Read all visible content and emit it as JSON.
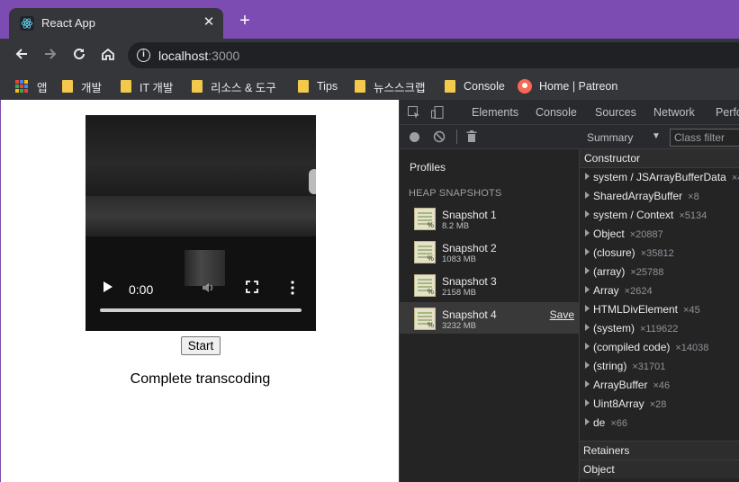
{
  "browser": {
    "tab_title": "React App",
    "new_tab_symbol": "+",
    "close_symbol": "✕",
    "url_host": "localhost",
    "url_port": ":3000"
  },
  "bookmarks": [
    {
      "label": "앱",
      "icon": "apps-icon"
    },
    {
      "label": "개발",
      "icon": "folder-icon"
    },
    {
      "label": "IT 개발",
      "icon": "folder-icon"
    },
    {
      "label": "리소스 & 도구",
      "icon": "folder-icon"
    },
    {
      "label": "Tips",
      "icon": "folder-icon"
    },
    {
      "label": "뉴스스크랩",
      "icon": "folder-icon"
    },
    {
      "label": "Console",
      "icon": "folder-icon"
    },
    {
      "label": "Home | Patreon",
      "icon": "patreon-icon"
    }
  ],
  "page": {
    "video_time": "0:00",
    "start_label": "Start",
    "status_text": "Complete transcoding"
  },
  "devtools": {
    "tabs": [
      "Elements",
      "Console",
      "Sources",
      "Network",
      "Perfo"
    ],
    "profiles_label": "Profiles",
    "heap_snapshots_label": "HEAP SNAPSHOTS",
    "snapshots": [
      {
        "name": "Snapshot 1",
        "size": "8.2 MB"
      },
      {
        "name": "Snapshot 2",
        "size": "1083 MB"
      },
      {
        "name": "Snapshot 3",
        "size": "2158 MB"
      },
      {
        "name": "Snapshot 4",
        "size": "3232 MB"
      }
    ],
    "save_label": "Save",
    "summary_label": "Summary",
    "class_filter_placeholder": "Class filter",
    "constructor_header": "Constructor",
    "constructors": [
      {
        "name": "system / JSArrayBufferData",
        "count": "×4"
      },
      {
        "name": "SharedArrayBuffer",
        "count": "×8"
      },
      {
        "name": "system / Context",
        "count": "×5134"
      },
      {
        "name": "Object",
        "count": "×20887"
      },
      {
        "name": "(closure)",
        "count": "×35812"
      },
      {
        "name": "(array)",
        "count": "×25788"
      },
      {
        "name": "Array",
        "count": "×2624"
      },
      {
        "name": "HTMLDivElement",
        "count": "×45"
      },
      {
        "name": "(system)",
        "count": "×119622"
      },
      {
        "name": "(compiled code)",
        "count": "×14038"
      },
      {
        "name": "(string)",
        "count": "×31701"
      },
      {
        "name": "ArrayBuffer",
        "count": "×46"
      },
      {
        "name": "Uint8Array",
        "count": "×28"
      },
      {
        "name": "de",
        "count": "×66"
      }
    ],
    "retainers_label": "Retainers",
    "object_label": "Object"
  },
  "colors": {
    "accent_purple": "#7c4cb3",
    "chrome_dark": "#35363a",
    "folder_yellow": "#f2c94c"
  }
}
